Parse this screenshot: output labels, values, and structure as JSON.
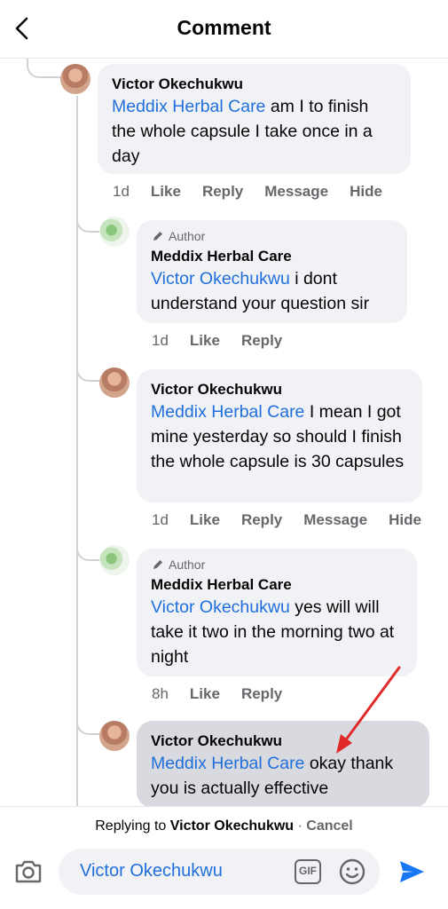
{
  "header": {
    "title": "Comment"
  },
  "comments": [
    {
      "name": "Victor Okechukwu",
      "mention": "Meddix Herbal Care",
      "text": "  am I to finish the whole capsule I take once in a day",
      "time": "1d",
      "actions": [
        "Like",
        "Reply",
        "Message",
        "Hide"
      ]
    },
    {
      "author_badge": "Author",
      "name": "Meddix Herbal Care",
      "mention": "Victor Okechukwu",
      "text": " i dont understand your question sir",
      "time": "1d",
      "actions": [
        "Like",
        "Reply"
      ]
    },
    {
      "name": "Victor Okechukwu",
      "mention": "Meddix Herbal Care",
      "text": " I mean I got mine yesterday so should I finish the whole capsule is 30 capsules",
      "time": "1d",
      "actions": [
        "Like",
        "Reply",
        "Message",
        "Hide"
      ]
    },
    {
      "author_badge": "Author",
      "name": "Meddix Herbal Care",
      "mention": "Victor Okechukwu",
      "text": " yes will will take it two in the morning two at night",
      "time": "8h",
      "actions": [
        "Like",
        "Reply"
      ]
    },
    {
      "name": "Victor Okechukwu",
      "mention": "Meddix Herbal Care",
      "text": " okay thank you is actually effective"
    }
  ],
  "reply_bar": {
    "prefix": "Replying to ",
    "name": "Victor Okechukwu",
    "separator": " · ",
    "cancel": "Cancel"
  },
  "composer": {
    "input_value": "Victor Okechukwu",
    "gif_label": "GIF"
  },
  "colors": {
    "mention": "#216fdb",
    "send": "#1877f2",
    "arrow": "#e02a2a"
  }
}
